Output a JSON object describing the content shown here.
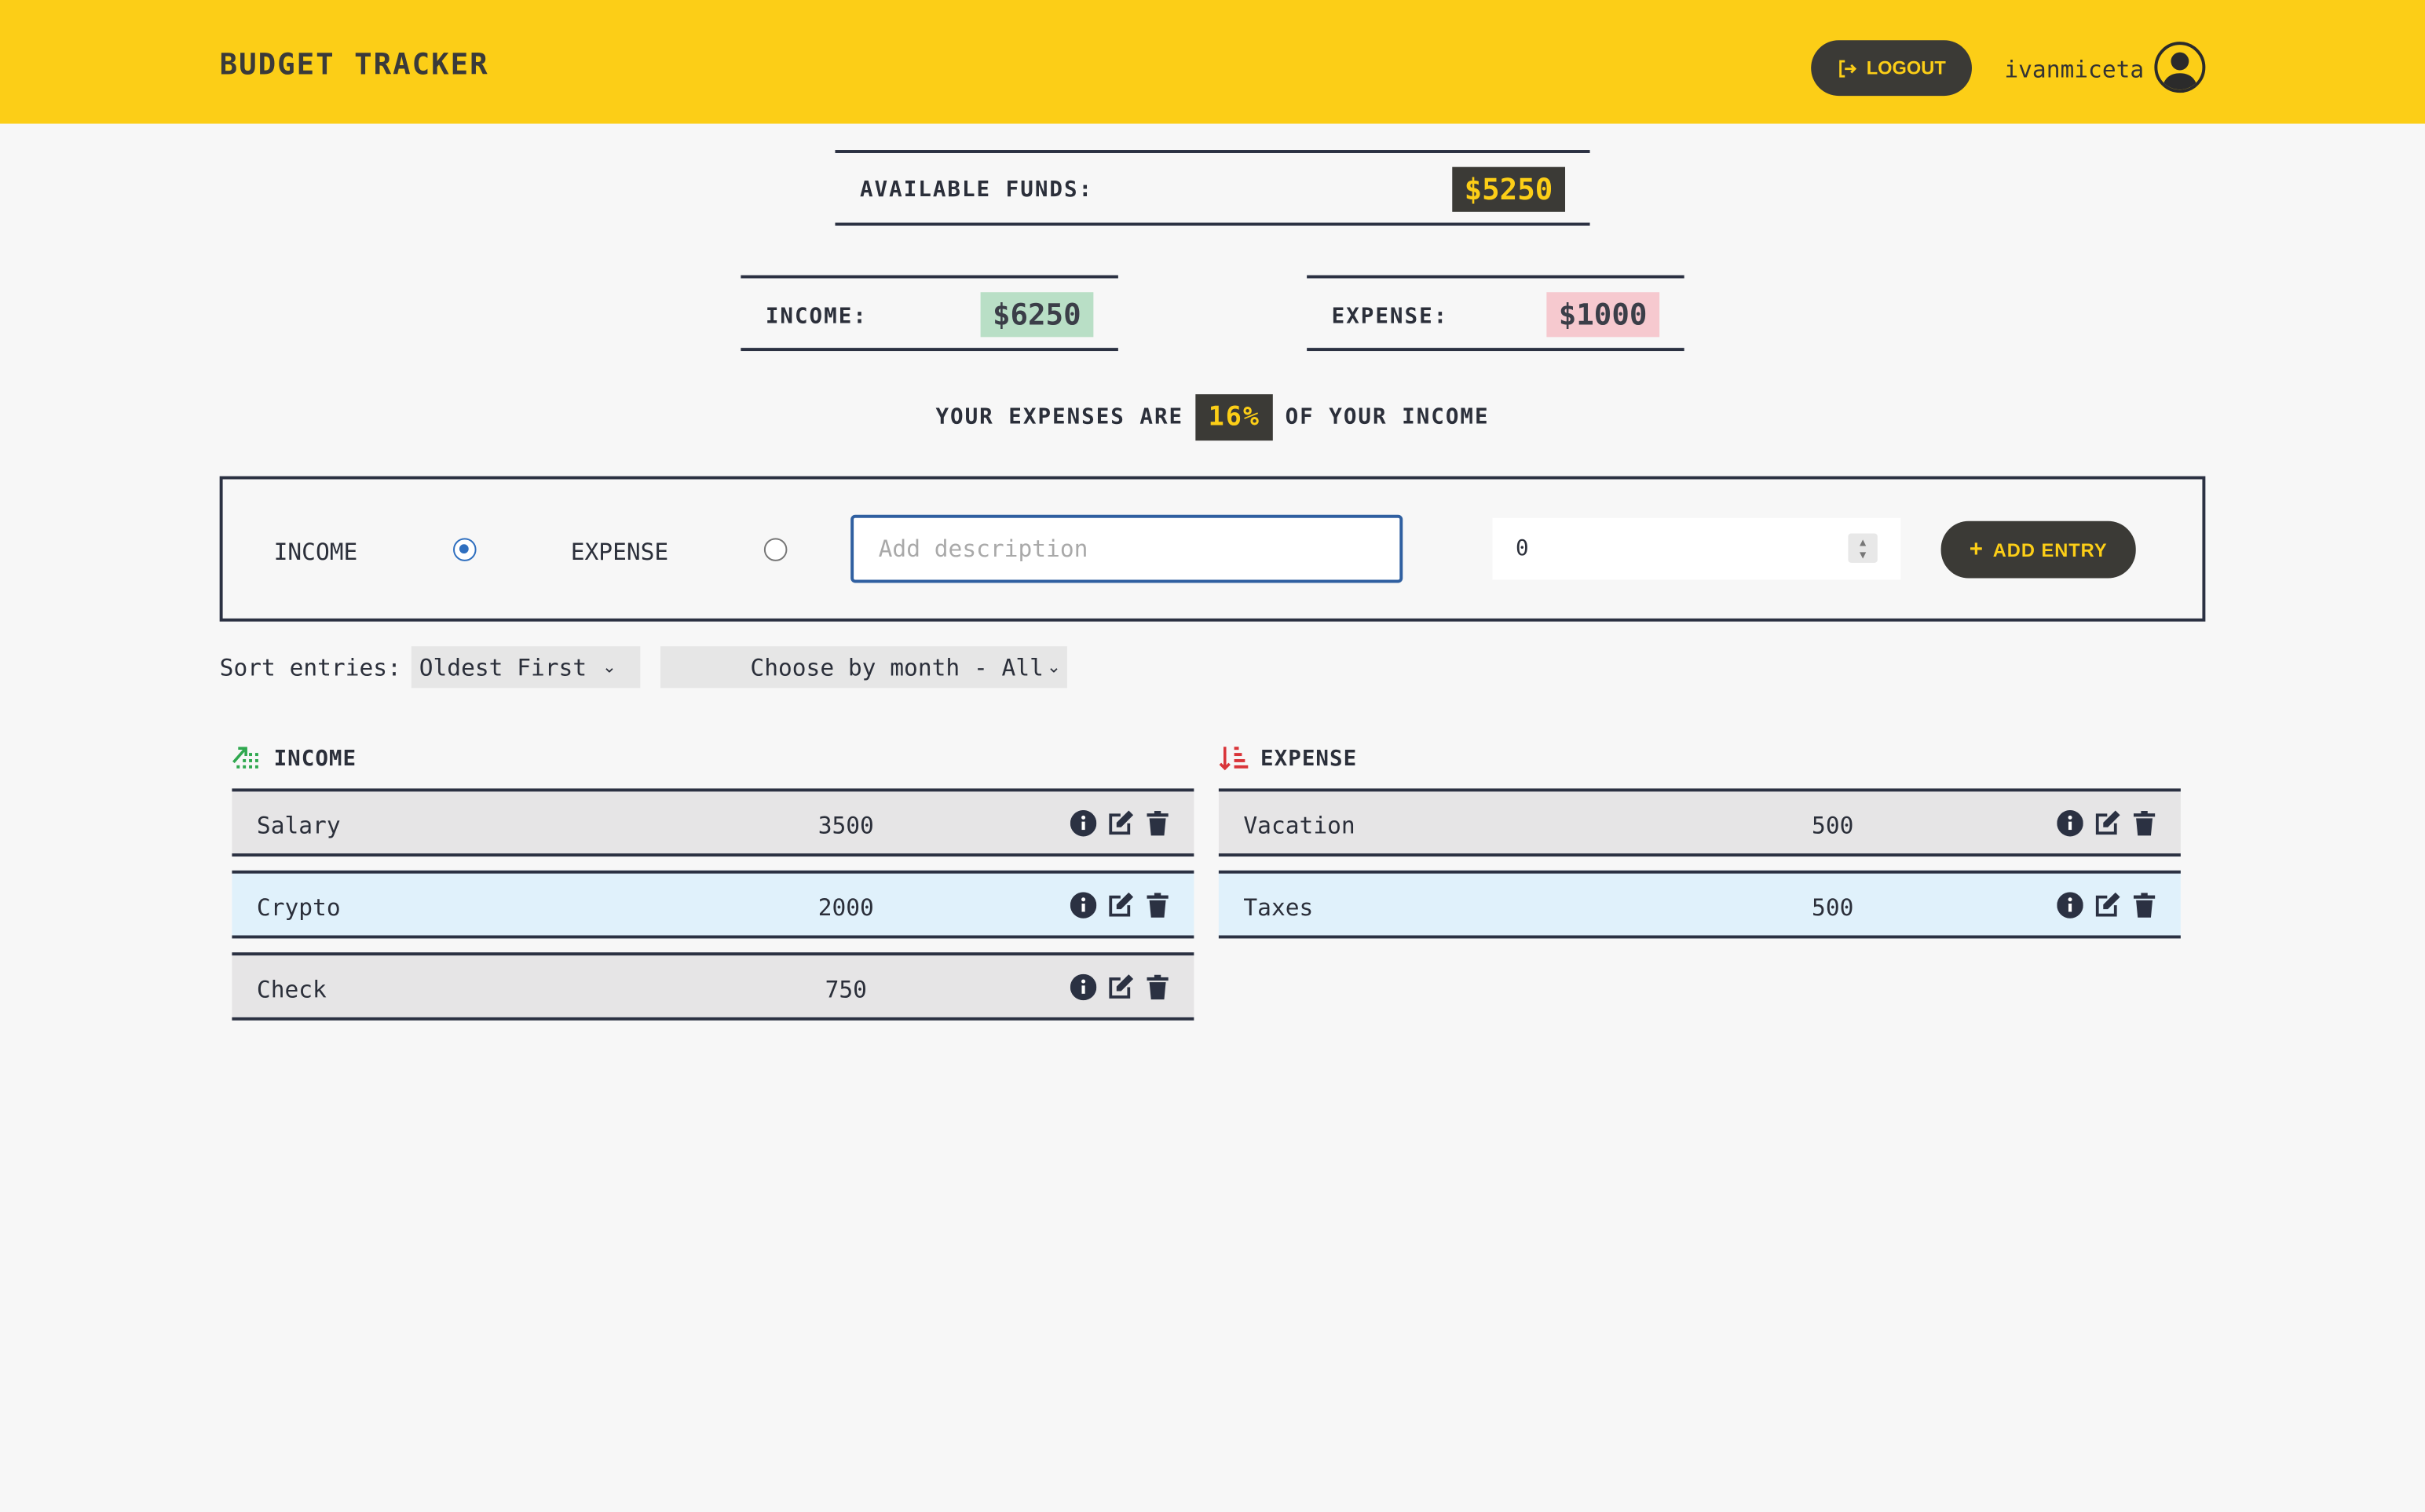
{
  "header": {
    "brand": "BUDGET TRACKER",
    "logout_label": "LOGOUT",
    "username": "ivanmiceta"
  },
  "summary": {
    "available_label": "AVAILABLE FUNDS:",
    "available_value": "$5250",
    "income_label": "INCOME:",
    "income_value": "$6250",
    "expense_label": "EXPENSE:",
    "expense_value": "$1000",
    "ratio_prefix": "YOUR EXPENSES ARE",
    "ratio_value": "16%",
    "ratio_suffix": "OF YOUR INCOME"
  },
  "form": {
    "income_label": "INCOME",
    "expense_label": "EXPENSE",
    "selected_type": "income",
    "description_placeholder": "Add description",
    "amount_value": "0",
    "add_label": "ADD ENTRY"
  },
  "filters": {
    "sort_label": "Sort entries:",
    "sort_value": "Oldest First",
    "month_value": "Choose by month - All"
  },
  "income": {
    "title": "INCOME",
    "entries": [
      {
        "description": "Salary",
        "amount": "3500"
      },
      {
        "description": "Crypto",
        "amount": "2000"
      },
      {
        "description": "Check",
        "amount": "750"
      }
    ]
  },
  "expense": {
    "title": "EXPENSE",
    "entries": [
      {
        "description": "Vacation",
        "amount": "500"
      },
      {
        "description": "Taxes",
        "amount": "500"
      }
    ]
  },
  "colors": {
    "accent": "#fcce17",
    "dark": "#3b3a36",
    "income_badge": "#b9dfc6",
    "expense_badge": "#f6c9cf",
    "income_icon": "#2fa84f",
    "expense_icon": "#d9353a"
  }
}
